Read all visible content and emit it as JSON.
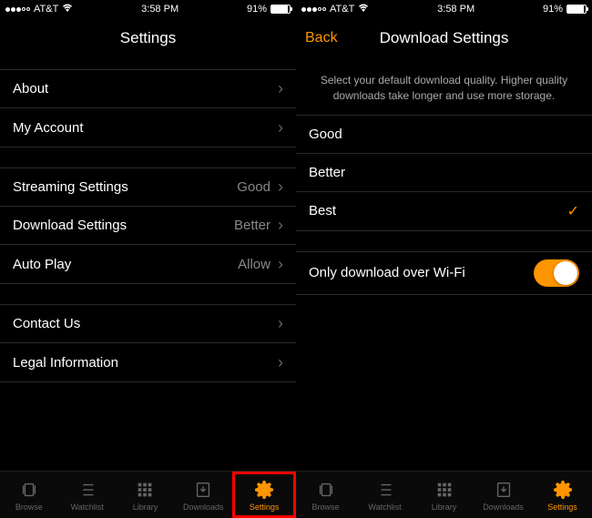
{
  "status": {
    "carrier": "AT&T",
    "time": "3:58 PM",
    "battery": "91%"
  },
  "left": {
    "title": "Settings",
    "sections": [
      {
        "rows": [
          {
            "label": "About"
          },
          {
            "label": "My Account"
          }
        ]
      },
      {
        "rows": [
          {
            "label": "Streaming Settings",
            "value": "Good"
          },
          {
            "label": "Download Settings",
            "value": "Better"
          },
          {
            "label": "Auto Play",
            "value": "Allow"
          }
        ]
      },
      {
        "rows": [
          {
            "label": "Contact Us"
          },
          {
            "label": "Legal Information"
          }
        ]
      }
    ],
    "tabs": [
      {
        "label": "Browse"
      },
      {
        "label": "Watchlist"
      },
      {
        "label": "Library"
      },
      {
        "label": "Downloads"
      },
      {
        "label": "Settings",
        "active": true,
        "highlighted": true
      }
    ]
  },
  "right": {
    "back": "Back",
    "title": "Download Settings",
    "description": "Select your default download quality. Higher quality downloads take longer and use more storage.",
    "options": [
      {
        "label": "Good"
      },
      {
        "label": "Better"
      },
      {
        "label": "Best",
        "selected": true
      }
    ],
    "toggle": {
      "label": "Only download over Wi-Fi",
      "on": true
    },
    "tabs": [
      {
        "label": "Browse"
      },
      {
        "label": "Watchlist"
      },
      {
        "label": "Library"
      },
      {
        "label": "Downloads"
      },
      {
        "label": "Settings",
        "active": true
      }
    ]
  }
}
